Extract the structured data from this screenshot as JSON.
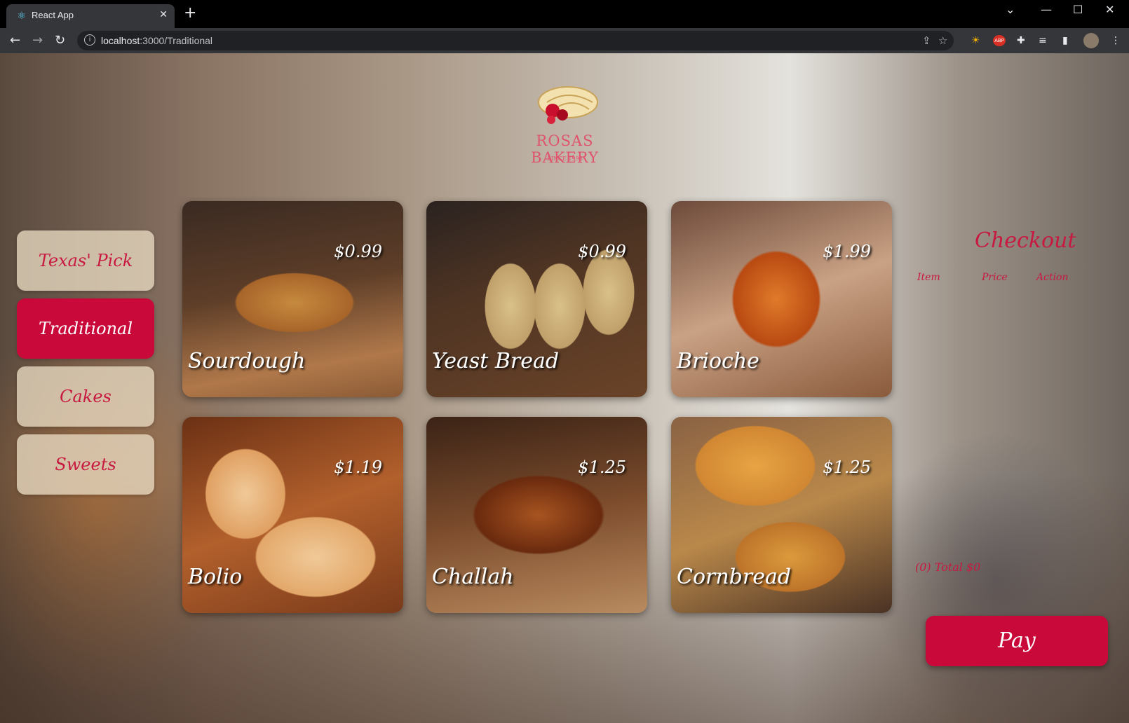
{
  "browser": {
    "tab_title": "React App",
    "tab_favicon": "react-logo-icon",
    "url_host": "localhost",
    "url_path": ":3000/Traditional",
    "extension_abp": "ABP"
  },
  "brand": {
    "name": "ROSAS BAKERY",
    "since": "SINCE 1998"
  },
  "sidebar": {
    "items": [
      {
        "label": "Texas' Pick",
        "active": false
      },
      {
        "label": "Traditional",
        "active": true
      },
      {
        "label": "Cakes",
        "active": false
      },
      {
        "label": "Sweets",
        "active": false
      }
    ]
  },
  "products": [
    {
      "name": "Sourdough",
      "price": "$0.99"
    },
    {
      "name": "Yeast Bread",
      "price": "$0.99"
    },
    {
      "name": "Brioche",
      "price": "$1.99"
    },
    {
      "name": "Bolio",
      "price": "$1.19"
    },
    {
      "name": "Challah",
      "price": "$1.25"
    },
    {
      "name": "Cornbread",
      "price": "$1.25"
    }
  ],
  "checkout": {
    "title": "Checkout",
    "columns": [
      "Item",
      "Price",
      "Action"
    ],
    "total": "(0) Total $0",
    "pay_label": "Pay"
  },
  "colors": {
    "accent": "#c8093a",
    "accent_text": "#c81940",
    "sidebar_bg": "#e8dac2"
  }
}
